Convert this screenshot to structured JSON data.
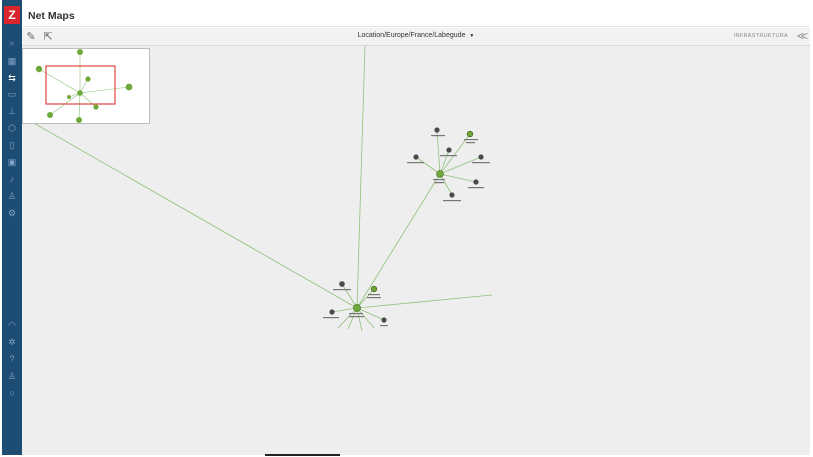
{
  "app": {
    "title": "Net Maps",
    "logo": "Z"
  },
  "sidebar": {
    "items": [
      {
        "name": "search-icon",
        "glyph": "⌕"
      },
      {
        "name": "dashboard-icon",
        "glyph": "▦"
      },
      {
        "name": "netmaps-icon",
        "glyph": "⇆"
      },
      {
        "name": "monitor-icon",
        "glyph": "▭"
      },
      {
        "name": "hierarchy-icon",
        "glyph": "⊥"
      },
      {
        "name": "cube-icon",
        "glyph": "⬡"
      },
      {
        "name": "document-icon",
        "glyph": "▯"
      },
      {
        "name": "chart-icon",
        "glyph": "▣"
      },
      {
        "name": "bell-icon",
        "glyph": "♪"
      },
      {
        "name": "users-icon",
        "glyph": "♙"
      },
      {
        "name": "settings-icon",
        "glyph": "⚙"
      },
      {
        "name": "support-icon",
        "glyph": "◠"
      },
      {
        "name": "share-icon",
        "glyph": "✲"
      },
      {
        "name": "help-icon",
        "glyph": "?"
      },
      {
        "name": "user-icon",
        "glyph": "♙"
      },
      {
        "name": "power-icon",
        "glyph": "○"
      }
    ]
  },
  "toolbar": {
    "location": "Location/Europe/France/Labegude",
    "panel_label": "INFRASTRUKTURA"
  },
  "colors": {
    "sidebar": "#1e4d73",
    "logo": "#d9252b",
    "link": "#8fc07a",
    "node_ok": "#6fa83a",
    "node_gray": "#4a4a4a",
    "viewport": "#e0473f"
  }
}
